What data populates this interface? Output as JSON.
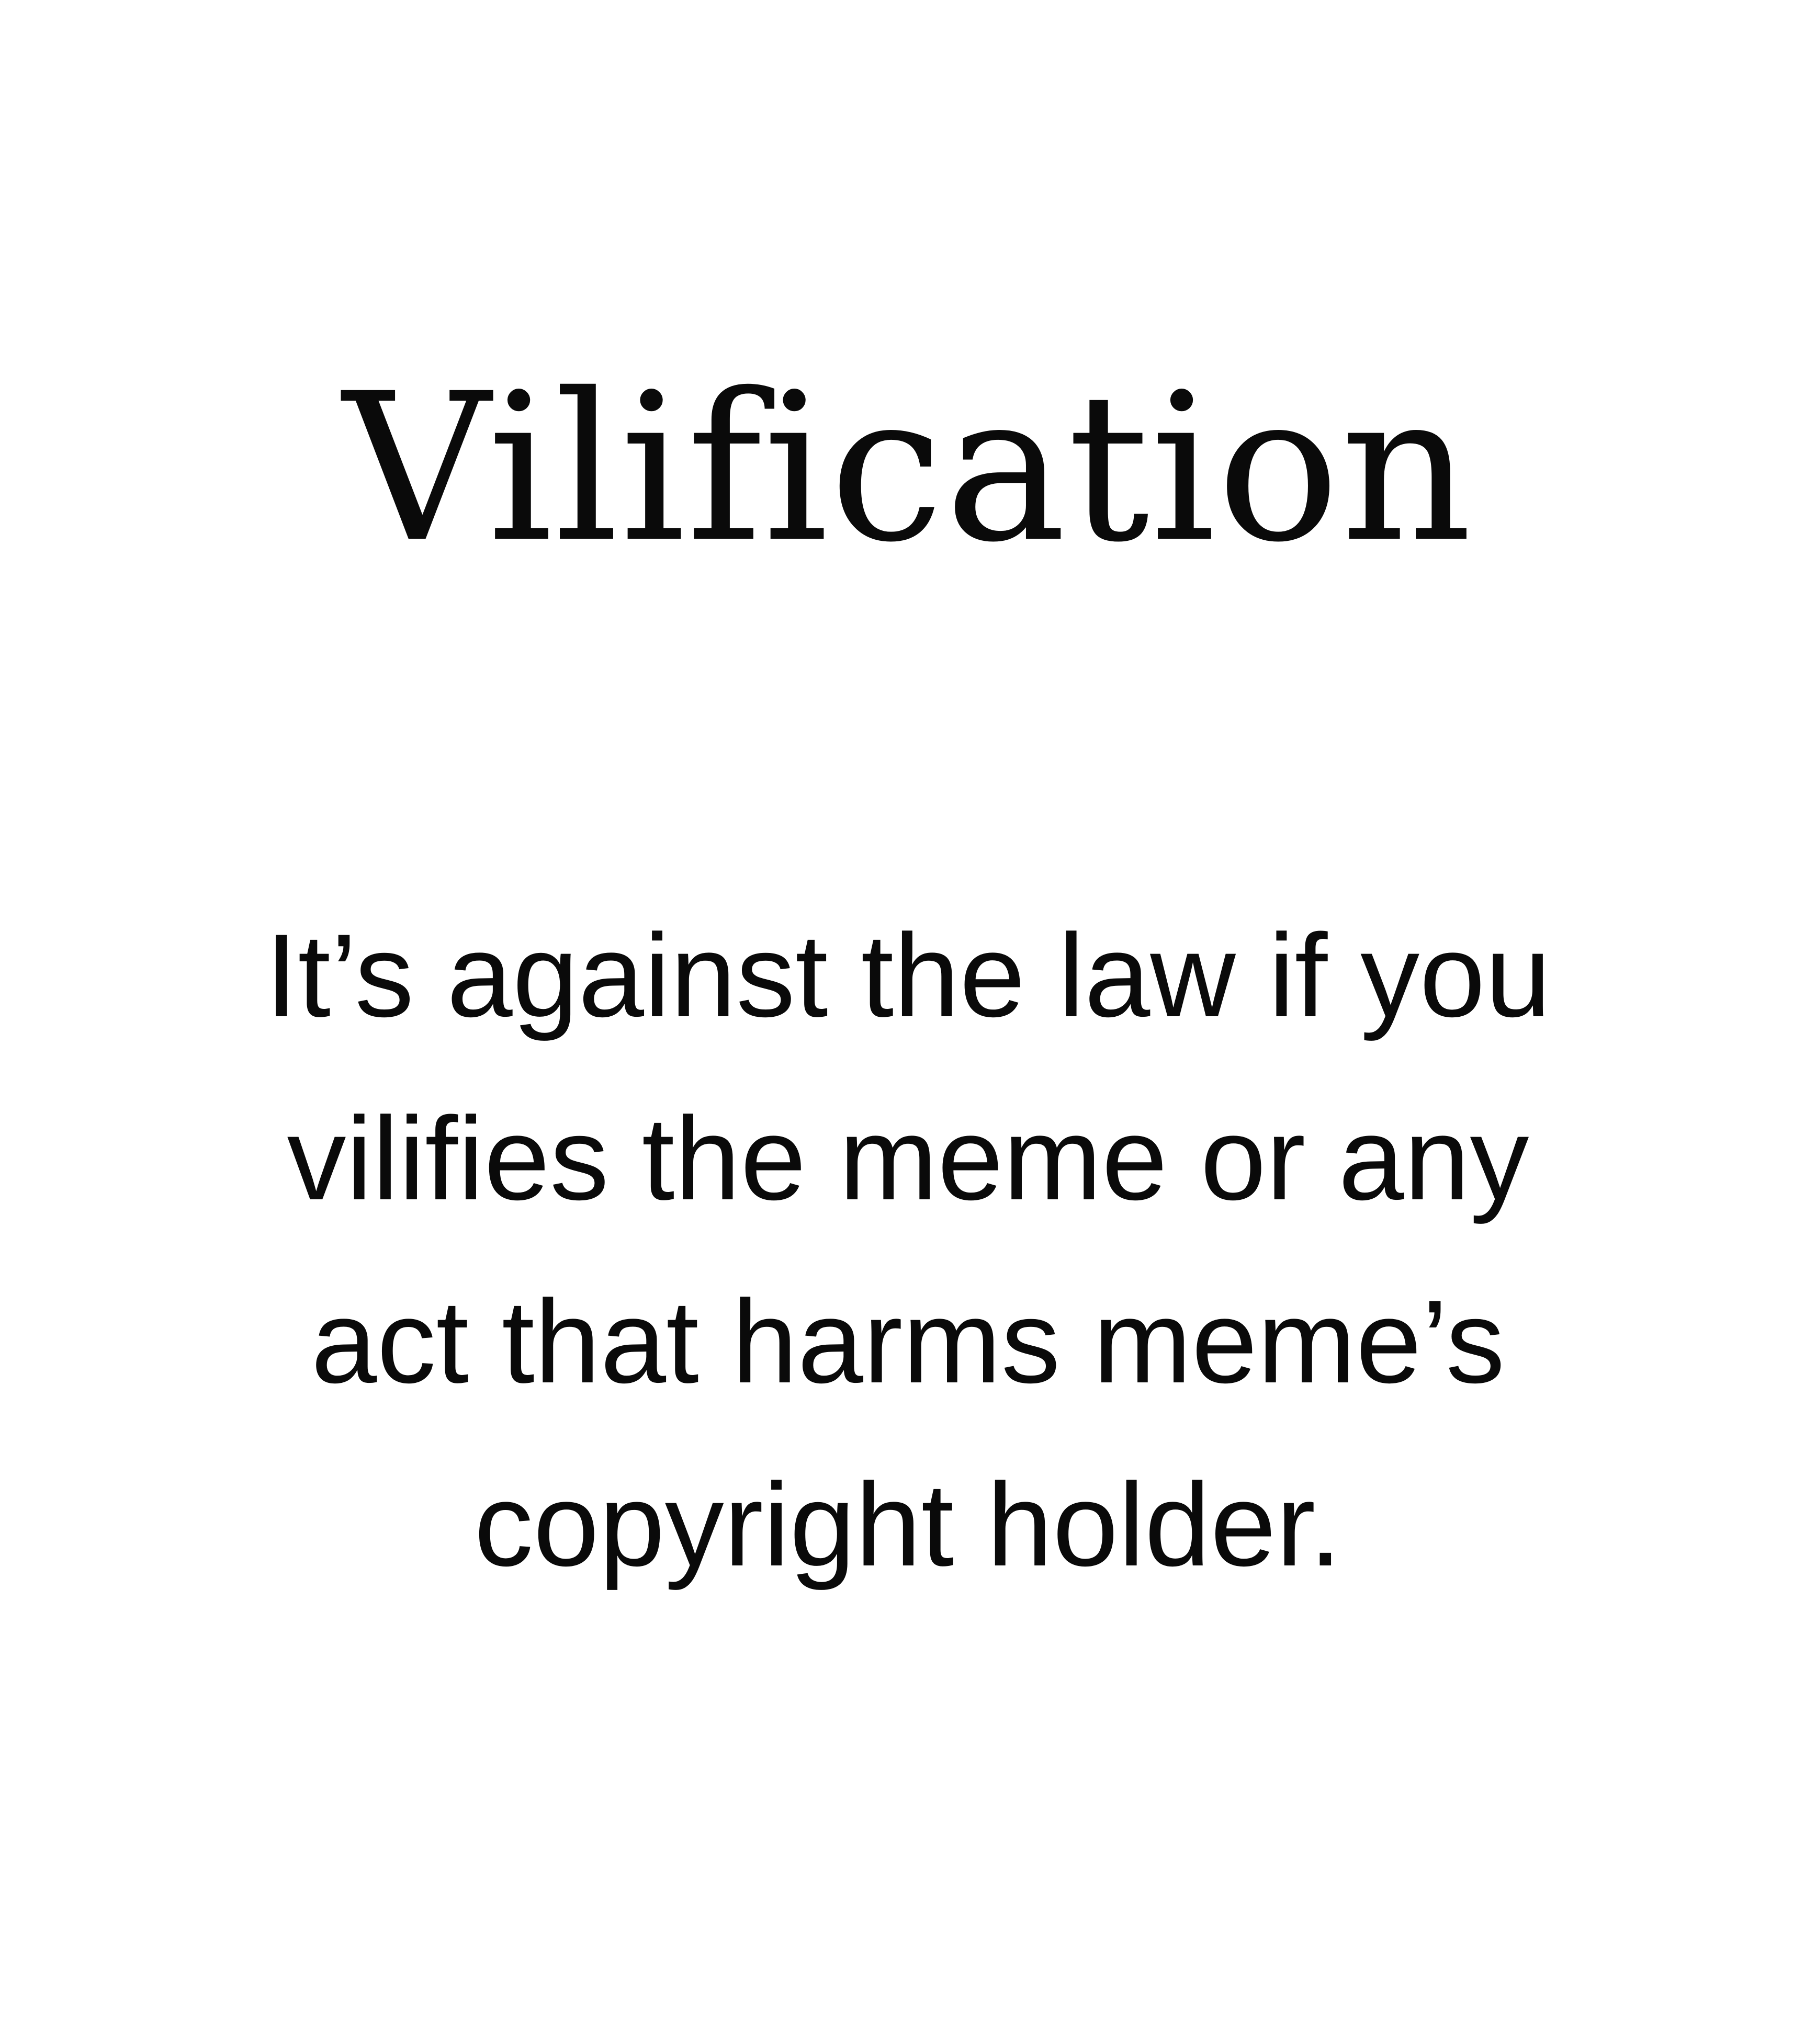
{
  "title": "Vilification",
  "body": {
    "lines": [
      "It’s against the law if you",
      "vilifies the meme or any",
      "act that harms meme’s",
      "copyright holder."
    ]
  },
  "colors": {
    "background": "#ffffff",
    "text": "#0a0a0a"
  }
}
